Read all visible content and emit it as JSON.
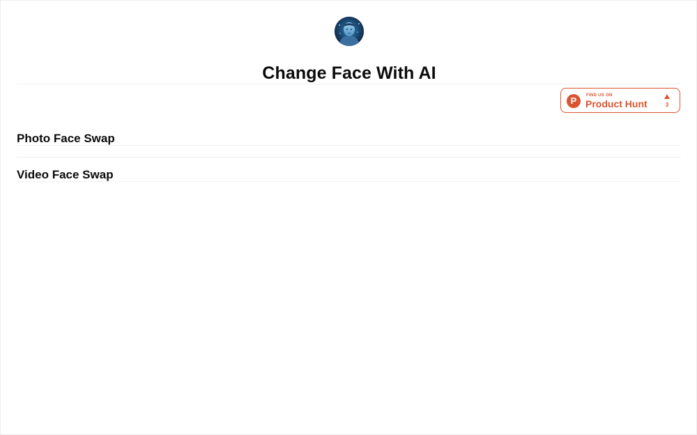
{
  "header": {
    "avatar_icon": "ai-face-avatar",
    "title": "Change Face With AI"
  },
  "badge": {
    "small_text": "FIND US ON",
    "name": "Product Hunt",
    "logo_letter": "P",
    "upvote_count": "3",
    "color": "#da552f"
  },
  "sections": [
    {
      "label": "Photo Face Swap"
    },
    {
      "label": "Video Face Swap"
    }
  ]
}
